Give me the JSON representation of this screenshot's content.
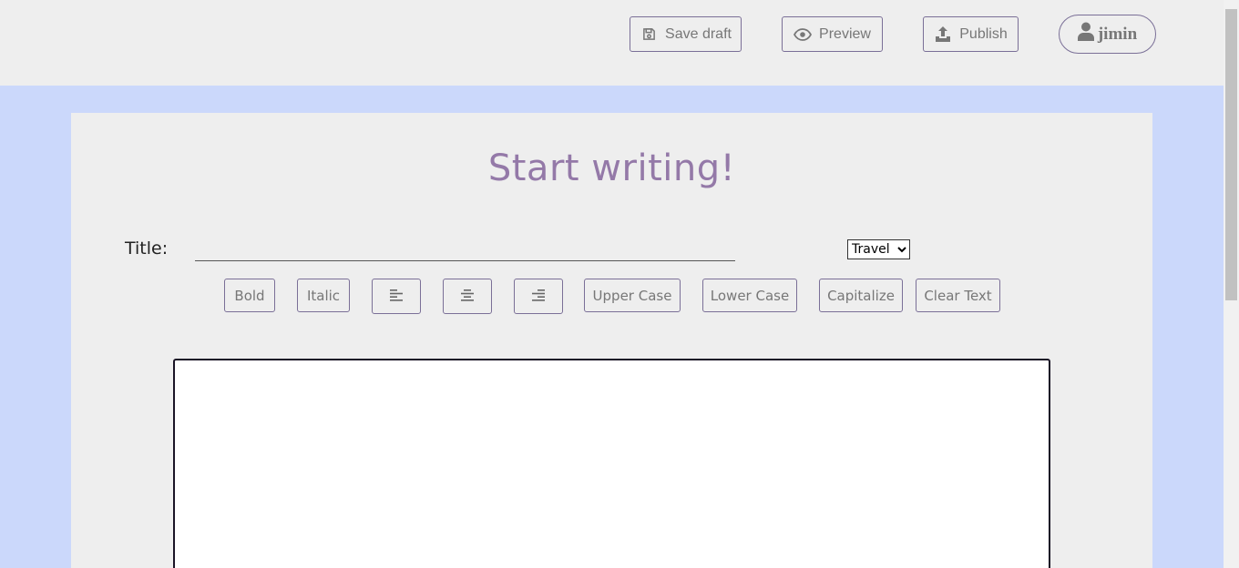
{
  "header": {
    "save_label": "Save draft",
    "preview_label": "Preview",
    "publish_label": "Publish",
    "user_label": "jimin"
  },
  "editor": {
    "heading": "Start writing!",
    "title_label": "Title:",
    "title_value": "",
    "category_selected": "Travel",
    "toolbar": {
      "bold": "Bold",
      "italic": "Italic",
      "upper": "Upper Case",
      "lower": "Lower Case",
      "capitalize": "Capitalize",
      "clear": "Clear Text"
    },
    "body_text": ""
  },
  "colors": {
    "accent": "#9479a8",
    "border": "#7a6f97",
    "workspace_bg": "#cbd8fb",
    "panel_bg": "#eeeeee"
  },
  "icons": {
    "save": "floppy-disk-icon",
    "preview": "eye-icon",
    "publish": "upload-icon",
    "user": "user-icon",
    "align_left": "align-left-icon",
    "align_center": "align-center-icon",
    "align_right": "align-right-icon"
  }
}
